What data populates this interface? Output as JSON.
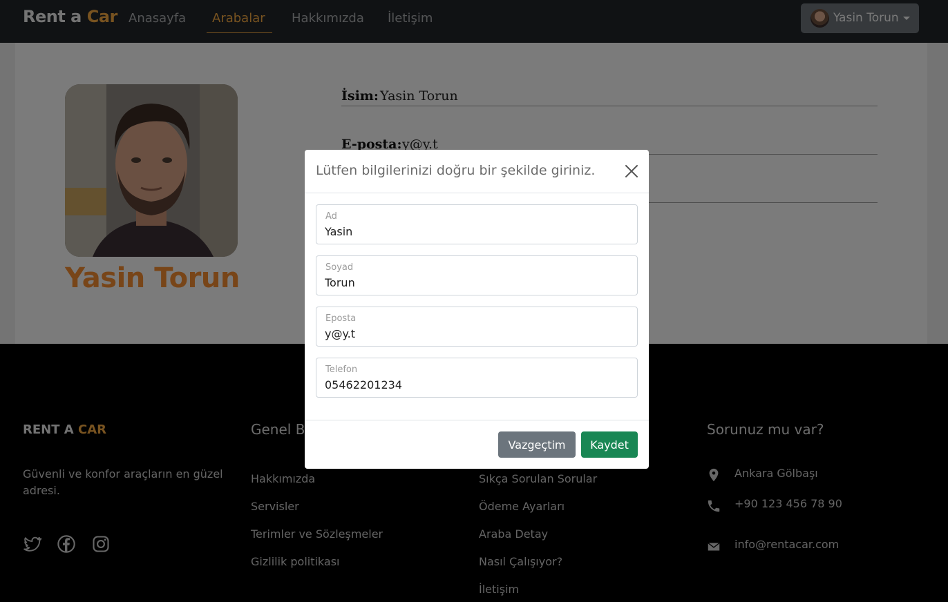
{
  "navbar": {
    "brand_part1": "Rent a",
    "brand_part2": "Car",
    "links": [
      "Anasayfa",
      "Arabalar",
      "Hakkımızda",
      "İletişim"
    ],
    "active_link": "Arabalar",
    "user_name": "Yasin Torun"
  },
  "profile": {
    "name": "Yasin Torun",
    "rows": [
      {
        "label": "İsim:",
        "value": "Yasin Torun"
      },
      {
        "label": "E-posta:",
        "value": "y@y.t"
      }
    ]
  },
  "modal": {
    "title": "Lütfen bilgilerinizi doğru bir şekilde giriniz.",
    "fields": [
      {
        "label": "Ad",
        "value": "Yasin"
      },
      {
        "label": "Soyad",
        "value": "Torun"
      },
      {
        "label": "Eposta",
        "value": "y@y.t"
      },
      {
        "label": "Telefon",
        "value": "05462201234"
      }
    ],
    "cancel_label": "Vazgeçtim",
    "save_label": "Kaydet"
  },
  "footer": {
    "brand_part1": "RENT A",
    "brand_part2": "CAR",
    "description": "Güvenli ve konfor araçların en güzel adresi.",
    "social_icons": [
      "twitter-icon",
      "facebook-icon",
      "instagram-icon"
    ],
    "col2_heading": "Genel B",
    "col2_links": [
      "Hakkımızda",
      "Servisler",
      "Terimler ve Sözleşmeler",
      "Gizlilik politikası"
    ],
    "col3_links": [
      "Sıkça Sorulan Sorular",
      "Ödeme Ayarları",
      "Araba Detay",
      "Nasıl Çalışıyor?",
      "İletişim"
    ],
    "col4_heading": "Sorunuz mu var?",
    "contact": {
      "address": "Ankara Gölbaşı",
      "phone": "+90 123 456 78 90",
      "email": "info@rentacar.com"
    }
  },
  "colors": {
    "accent": "#f0a640",
    "profile_name": "#f08a30",
    "save_button": "#198754",
    "cancel_button": "#6c757d"
  }
}
